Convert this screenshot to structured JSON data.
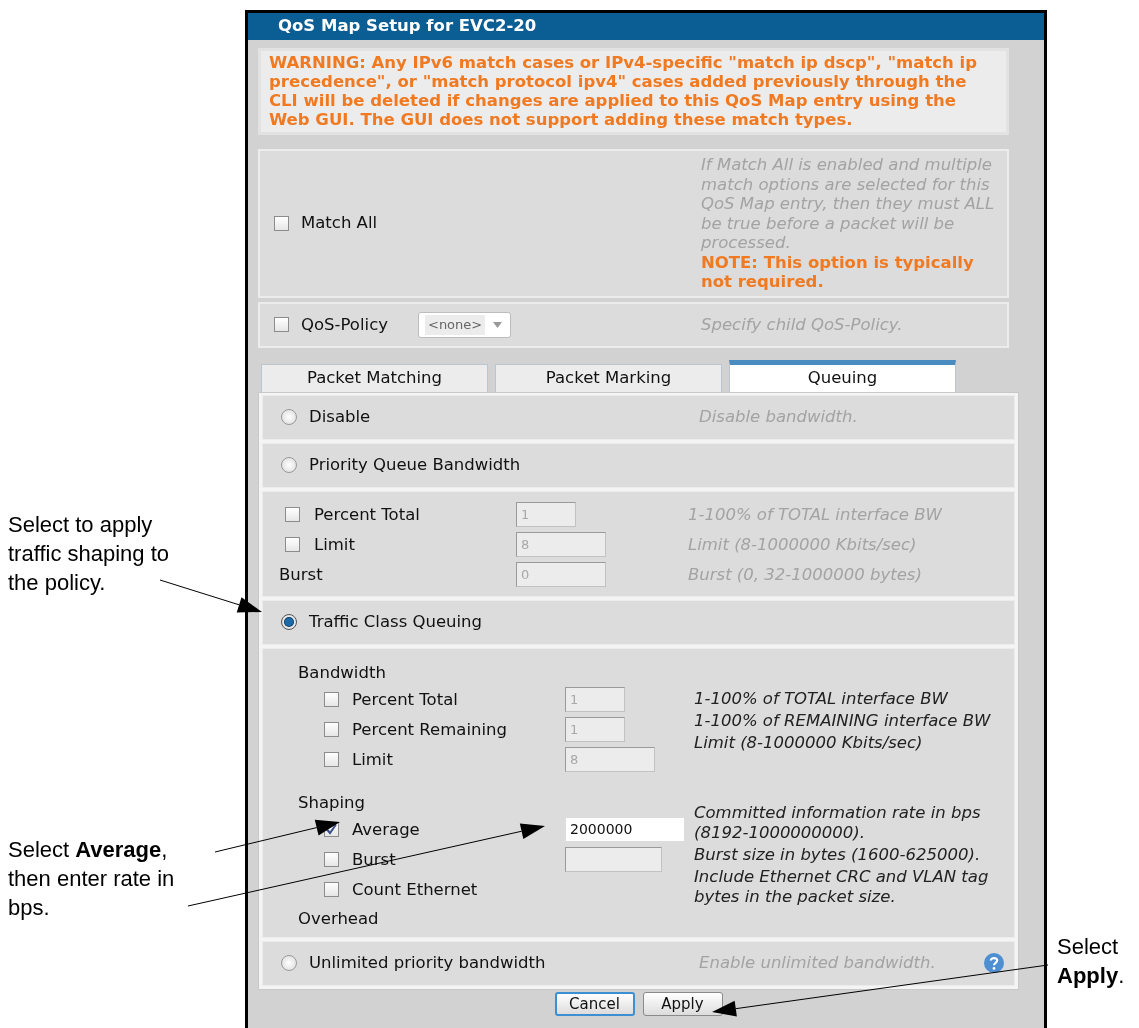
{
  "annotations": {
    "left": [
      {
        "text": "Select to apply traffic shaping to the policy."
      },
      {
        "text": "Select **Average**, then enter rate in bps."
      }
    ],
    "right": [
      {
        "text": "Select **Apply**."
      }
    ]
  },
  "dialog": {
    "title": "QoS Map Setup for EVC2-20",
    "warning": "WARNING: Any IPv6 match cases or IPv4-specific \"match ip dscp\", \"match ip precedence\", or \"match protocol ipv4\" cases added previously through the CLI will be deleted if changes are applied to this QoS Map entry using the Web GUI. The GUI does not support adding these match types.",
    "match_all": {
      "label": "Match All",
      "checked": false,
      "help": "If Match All is enabled and multiple match options are selected for this QoS Map entry, then they must ALL be true before a packet will be processed.",
      "note": "NOTE: This option is typically not required."
    },
    "qos_policy": {
      "label": "QoS-Policy",
      "checked": false,
      "value": "<none>",
      "help": "Specify child QoS-Policy."
    },
    "tabs": [
      {
        "label": "Packet Matching",
        "selected": false
      },
      {
        "label": "Packet Marking",
        "selected": false
      },
      {
        "label": "Queuing",
        "selected": true
      }
    ],
    "queuing": [
      {
        "kind": "radio",
        "label": "Disable",
        "selected": false,
        "help": "Disable bandwidth."
      },
      {
        "kind": "radio",
        "label": "Priority Queue Bandwidth",
        "selected": false
      },
      {
        "kind": "fields",
        "rows": [
          {
            "kind": "check",
            "label": "Percent Total",
            "checked": false,
            "value": "1",
            "disabled": true,
            "help": "1-100% of TOTAL interface BW"
          },
          {
            "kind": "check",
            "label": "Limit",
            "checked": false,
            "value": "8",
            "disabled": true,
            "help": "Limit (8-1000000 Kbits/sec)"
          },
          {
            "kind": "plain",
            "label": "Burst",
            "value": "0",
            "disabled": true,
            "help": "Burst (0, 32-1000000 bytes)"
          }
        ]
      },
      {
        "kind": "radio",
        "label": "Traffic Class Queuing",
        "selected": true
      },
      {
        "kind": "groups",
        "groups": [
          {
            "heading": "Bandwidth",
            "rows": [
              {
                "label": "Percent Total",
                "checked": false,
                "value": "1",
                "disabled": true,
                "help": "1-100% of TOTAL interface BW"
              },
              {
                "label": "Percent Remaining",
                "checked": false,
                "value": "1",
                "disabled": true,
                "help": "1-100% of REMAINING interface BW"
              },
              {
                "label": "Limit",
                "checked": false,
                "value": "8",
                "disabled": true,
                "help": "Limit (8-1000000 Kbits/sec)"
              }
            ]
          },
          {
            "heading": "Shaping",
            "rows": [
              {
                "label": "Average",
                "checked": true,
                "value": "2000000",
                "disabled": false,
                "help": "Committed information rate in bps (8192-1000000000)."
              },
              {
                "label": "Burst",
                "checked": false,
                "disabled": true,
                "help": "Burst size in bytes (1600-625000)."
              },
              {
                "label": "Count Ethernet",
                "checked": false,
                "help": "Include Ethernet CRC and VLAN tag bytes in the packet size."
              }
            ]
          }
        ],
        "trailer": "Overhead"
      },
      {
        "kind": "radio",
        "label": "Unlimited priority bandwidth",
        "selected": false,
        "help": "Enable unlimited bandwidth.",
        "help_button": true
      }
    ],
    "buttons": [
      {
        "label": "Cancel",
        "focused": true
      },
      {
        "label": "Apply",
        "focused": false
      }
    ]
  }
}
